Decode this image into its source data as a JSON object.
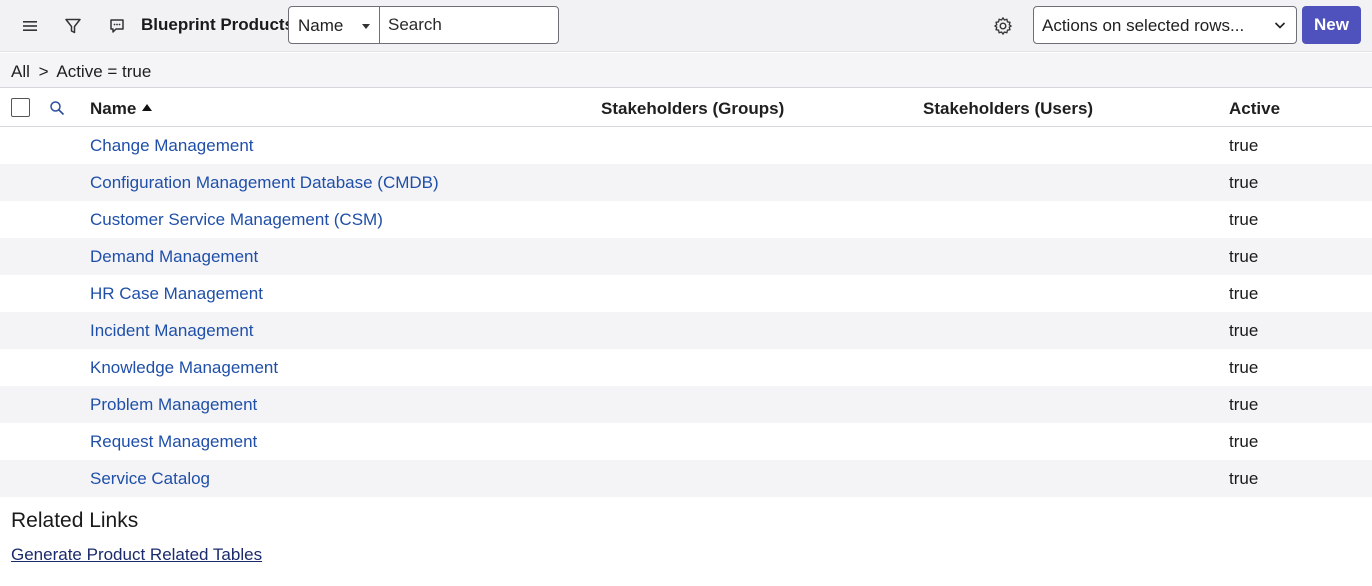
{
  "header": {
    "title": "Blueprint Products",
    "menu_icon": "hamburger-menu-icon",
    "filter_icon": "filter-funnel-icon",
    "comment_icon": "chat-bubble-icon",
    "settings_icon": "gear-icon"
  },
  "search": {
    "field_selected": "Name",
    "placeholder": "Search"
  },
  "actions": {
    "select_label": "Actions on selected rows...",
    "new_label": "New",
    "new_color": "#4f52bd"
  },
  "breadcrumb": {
    "all": "All",
    "separator": ">",
    "filter": "Active = true"
  },
  "table": {
    "columns": {
      "name": "Name",
      "groups": "Stakeholders (Groups)",
      "users": "Stakeholders (Users)",
      "active": "Active"
    },
    "sort_column": "Name",
    "sort_direction": "ascending",
    "rows": [
      {
        "name": "Change Management",
        "groups": "",
        "users": "",
        "active": "true"
      },
      {
        "name": "Configuration Management Database (CMDB)",
        "groups": "",
        "users": "",
        "active": "true"
      },
      {
        "name": "Customer Service Management (CSM)",
        "groups": "",
        "users": "",
        "active": "true"
      },
      {
        "name": "Demand Management",
        "groups": "",
        "users": "",
        "active": "true"
      },
      {
        "name": "HR Case Management",
        "groups": "",
        "users": "",
        "active": "true"
      },
      {
        "name": "Incident Management",
        "groups": "",
        "users": "",
        "active": "true"
      },
      {
        "name": "Knowledge Management",
        "groups": "",
        "users": "",
        "active": "true"
      },
      {
        "name": "Problem Management",
        "groups": "",
        "users": "",
        "active": "true"
      },
      {
        "name": "Request Management",
        "groups": "",
        "users": "",
        "active": "true"
      },
      {
        "name": "Service Catalog",
        "groups": "",
        "users": "",
        "active": "true"
      }
    ]
  },
  "related": {
    "title": "Related Links",
    "links": [
      "Generate Product Related Tables"
    ]
  }
}
